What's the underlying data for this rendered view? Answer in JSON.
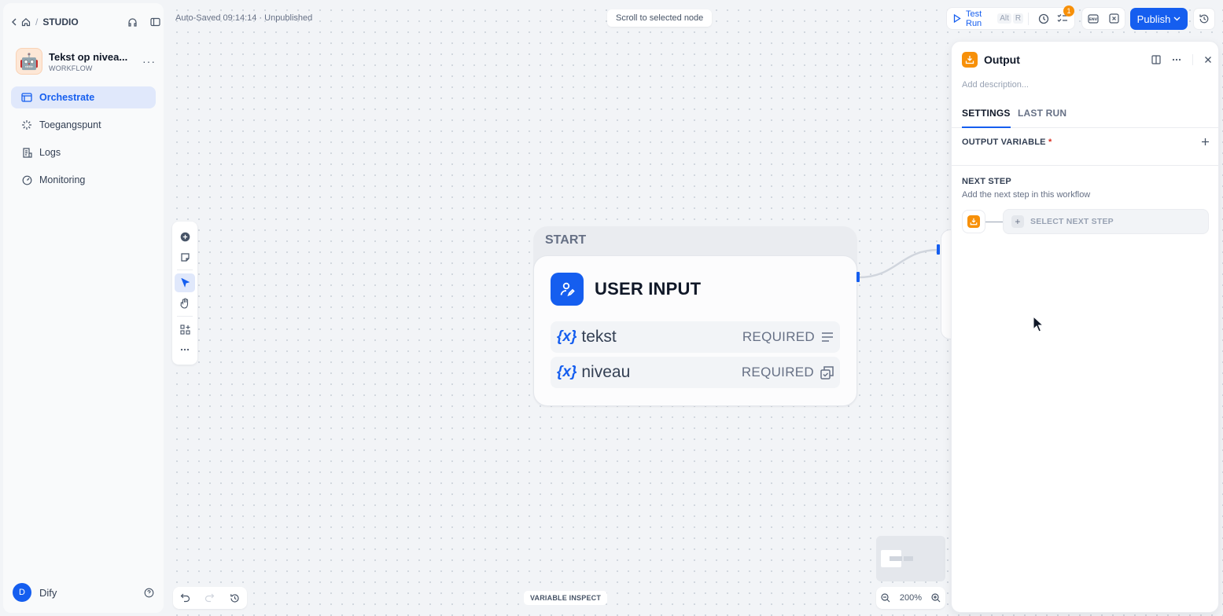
{
  "sidebar": {
    "breadcrumb_sep": "/",
    "studio": "STUDIO",
    "app": {
      "name": "Tekst op nivea...",
      "type": "WORKFLOW",
      "emoji": "🤖",
      "more": "···"
    },
    "nav": [
      {
        "label": "Orchestrate",
        "icon": "orchestrate-icon",
        "active": true
      },
      {
        "label": "Toegangspunt",
        "icon": "access-point-icon",
        "active": false
      },
      {
        "label": "Logs",
        "icon": "logs-icon",
        "active": false
      },
      {
        "label": "Monitoring",
        "icon": "monitoring-icon",
        "active": false
      }
    ],
    "user": {
      "initial": "D",
      "name": "Dify"
    }
  },
  "canvas": {
    "autosave": "Auto-Saved 09:14:14 · Unpublished",
    "scroll_to_selected": "Scroll to selected node",
    "variable_inspect": "VARIABLE INSPECT",
    "zoom": "200%"
  },
  "toolbar": {
    "test_run": "Test Run",
    "kbd_alt": "Alt",
    "kbd_r": "R",
    "checklist_badge": "1",
    "publish": "Publish"
  },
  "start_node": {
    "header": "START",
    "title": "USER INPUT",
    "variables": [
      {
        "symbol": "{x}",
        "name": "tekst",
        "required": "REQUIRED",
        "type_icon": "paragraph-icon"
      },
      {
        "symbol": "{x}",
        "name": "niveau",
        "required": "REQUIRED",
        "type_icon": "select-icon"
      }
    ]
  },
  "panel": {
    "title": "Output",
    "description_placeholder": "Add description...",
    "tabs": [
      {
        "label": "SETTINGS",
        "active": true
      },
      {
        "label": "LAST RUN",
        "active": false
      }
    ],
    "output_variable": {
      "title": "OUTPUT VARIABLE",
      "required_mark": "*"
    },
    "next_step": {
      "title": "NEXT STEP",
      "subtitle": "Add the next step in this workflow",
      "select_label": "SELECT NEXT STEP"
    }
  },
  "colors": {
    "primary": "#155eef",
    "output_accent": "#f79009",
    "required": "#d92d20"
  }
}
